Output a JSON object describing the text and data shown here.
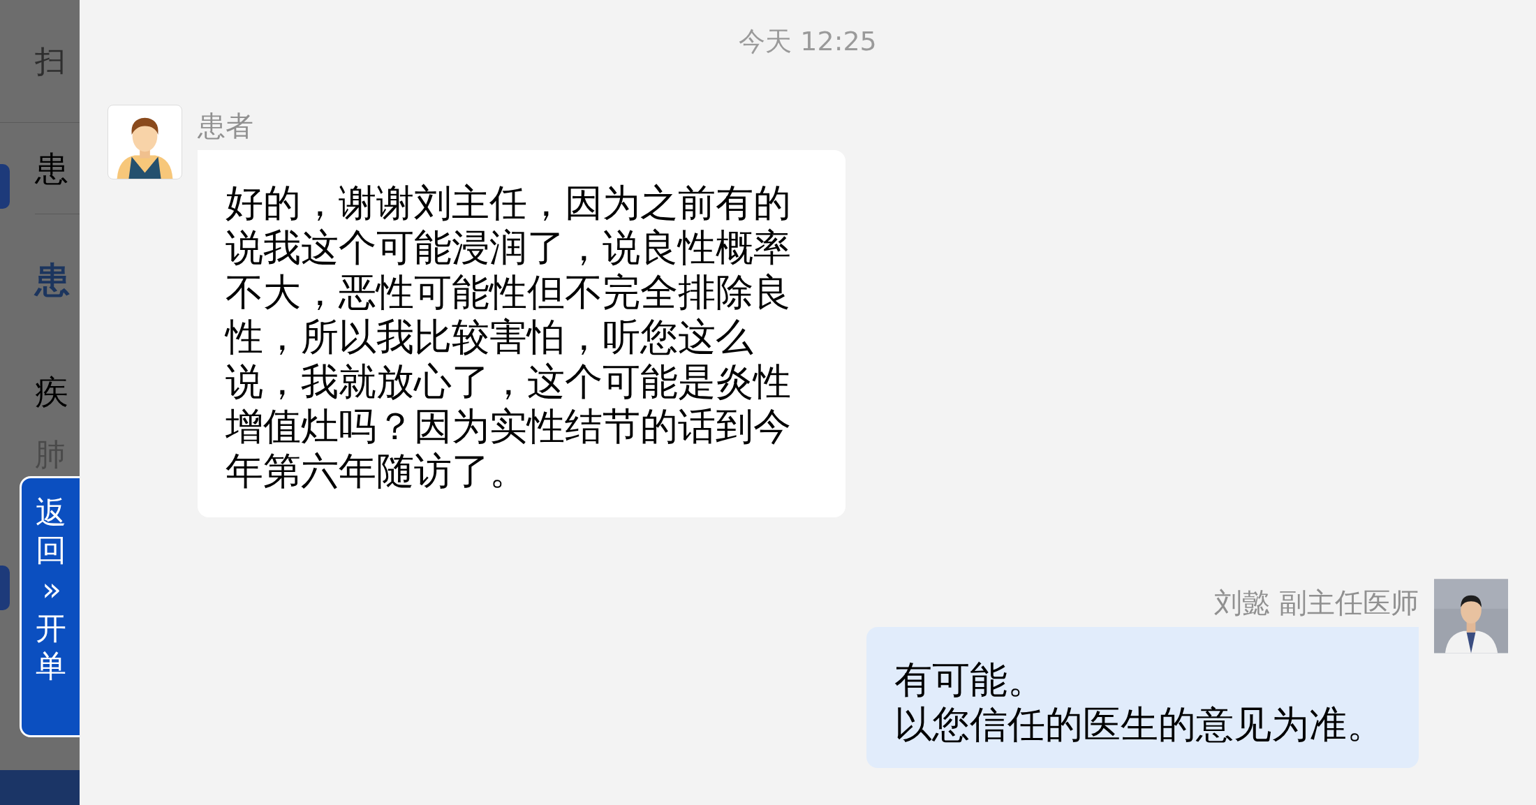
{
  "background_page": {
    "items": [
      {
        "text": "扫",
        "kind": "plain"
      },
      {
        "text": "患",
        "kind": "row"
      },
      {
        "text": "患",
        "kind": "heading"
      },
      {
        "text": "疾",
        "kind": "row"
      },
      {
        "text": "肺",
        "kind": "sub"
      }
    ]
  },
  "return_button": {
    "label_top": "返回",
    "arrow": "»",
    "label_bottom": "开单"
  },
  "chat": {
    "timestamp": "今天 12:25",
    "messages": [
      {
        "sender": "患者",
        "kind": "received",
        "lines": [
          "好的，谢谢刘主任，因为之前有的说我这个可能浸润了，说良性概率不大，恶性可能性但不完全排除良性，所以我比较害怕，听您这么说，我就放心了，这个可能是炎性增值灶吗？因为实性结节的话到今年第六年随访了。"
        ]
      },
      {
        "sender": "刘懿 副主任医师",
        "kind": "sent",
        "lines": [
          "有可能。",
          "以您信任的医生的意见为准。"
        ]
      }
    ]
  }
}
